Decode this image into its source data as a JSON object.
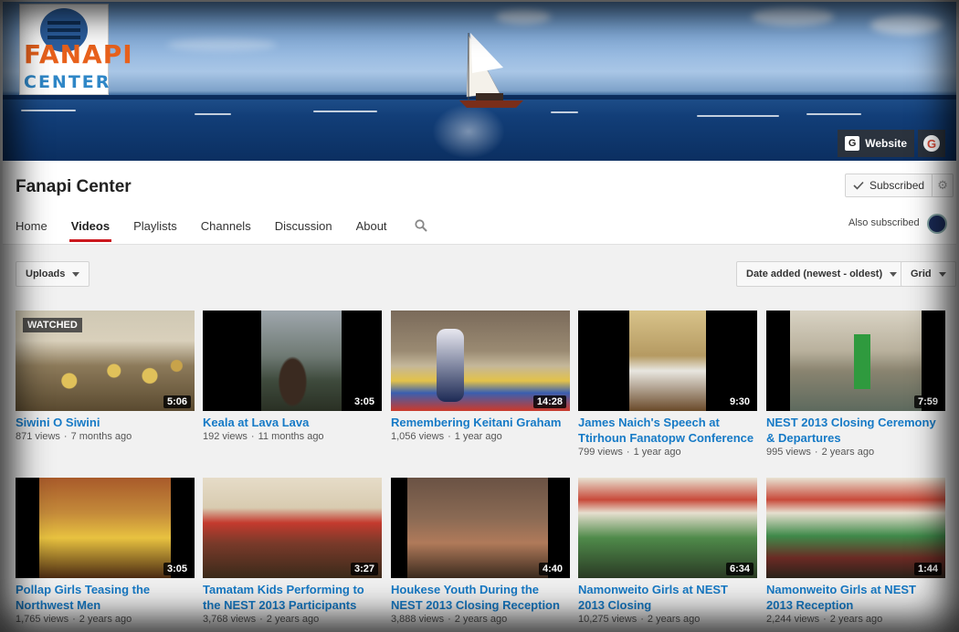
{
  "banner": {
    "logo_title": "FANAPI",
    "logo_sub": "CENTER",
    "links": {
      "website_label": "Website",
      "website_icon": "G",
      "google_icon": "G"
    }
  },
  "channel": {
    "title": "Fanapi Center",
    "subscribe_label": "Subscribed",
    "also_subscribed_label": "Also subscribed"
  },
  "tabs": [
    {
      "label": "Home"
    },
    {
      "label": "Videos"
    },
    {
      "label": "Playlists"
    },
    {
      "label": "Channels"
    },
    {
      "label": "Discussion"
    },
    {
      "label": "About"
    }
  ],
  "toolbar": {
    "uploads_label": "Uploads",
    "sort_label": "Date added (newest - oldest)",
    "view_label": "Grid"
  },
  "videos": [
    {
      "title": "Siwini O Siwini",
      "views": "871 views",
      "age": "7 months ago",
      "duration": "5:06",
      "watched": "WATCHED"
    },
    {
      "title": "Keala at Lava Lava",
      "views": "192 views",
      "age": "11 months ago",
      "duration": "3:05"
    },
    {
      "title": "Remembering Keitani Graham",
      "views": "1,056 views",
      "age": "1 year ago",
      "duration": "14:28"
    },
    {
      "title": "James Naich's Speech at Ttirhoun Fanatopw Conference",
      "views": "799 views",
      "age": "1 year ago",
      "duration": "9:30"
    },
    {
      "title": "NEST 2013 Closing Ceremony & Departures",
      "views": "995 views",
      "age": "2 years ago",
      "duration": "7:59"
    },
    {
      "title": "Pollap Girls Teasing the Northwest Men",
      "views": "1,765 views",
      "age": "2 years ago",
      "duration": "3:05"
    },
    {
      "title": "Tamatam Kids Performing to the NEST 2013 Participants",
      "views": "3,768 views",
      "age": "2 years ago",
      "duration": "3:27"
    },
    {
      "title": "Houkese Youth During the NEST 2013 Closing Reception",
      "views": "3,888 views",
      "age": "2 years ago",
      "duration": "4:40"
    },
    {
      "title": "Namonweito Girls at NEST 2013 Closing",
      "views": "10,275 views",
      "age": "2 years ago",
      "duration": "6:34"
    },
    {
      "title": "Namonweito Girls at NEST 2013 Reception",
      "views": "2,244 views",
      "age": "2 years ago",
      "duration": "1:44"
    }
  ]
}
